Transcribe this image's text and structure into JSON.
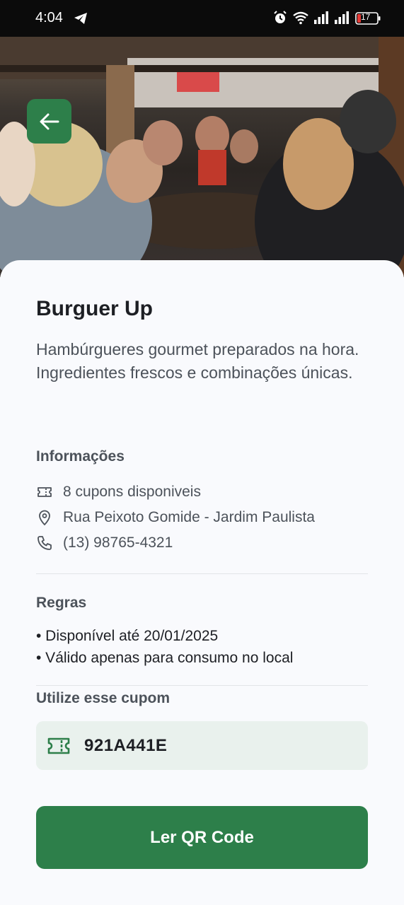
{
  "status_bar": {
    "time": "4:04",
    "battery": "17",
    "icons": [
      "telegram-icon",
      "alarm-icon",
      "wifi-icon",
      "signal-icon",
      "signal-icon",
      "battery-icon"
    ]
  },
  "header": {
    "back_icon": "arrow-left-icon"
  },
  "place": {
    "title": "Burguer Up",
    "description": "Hambúrgueres gourmet preparados na hora. Ingredientes frescos e combinações únicas."
  },
  "info": {
    "title": "Informações",
    "items": [
      {
        "icon": "ticket-icon",
        "text": "8 cupons disponiveis"
      },
      {
        "icon": "map-pin-icon",
        "text": "Rua Peixoto Gomide - Jardim Paulista"
      },
      {
        "icon": "phone-icon",
        "text": "(13) 98765-4321"
      }
    ]
  },
  "rules": {
    "title": "Regras",
    "items": [
      "• Disponível até 20/01/2025",
      "• Válido apenas para consumo no local"
    ]
  },
  "coupon": {
    "title": "Utilize esse cupom",
    "code": "921A441E",
    "icon": "ticket-icon"
  },
  "actions": {
    "qr_label": "Ler QR Code"
  },
  "colors": {
    "accent": "#2d7f4a",
    "coupon_bg": "#e9f1ed",
    "text_primary": "#1d1f24",
    "text_secondary": "#4c525a"
  }
}
